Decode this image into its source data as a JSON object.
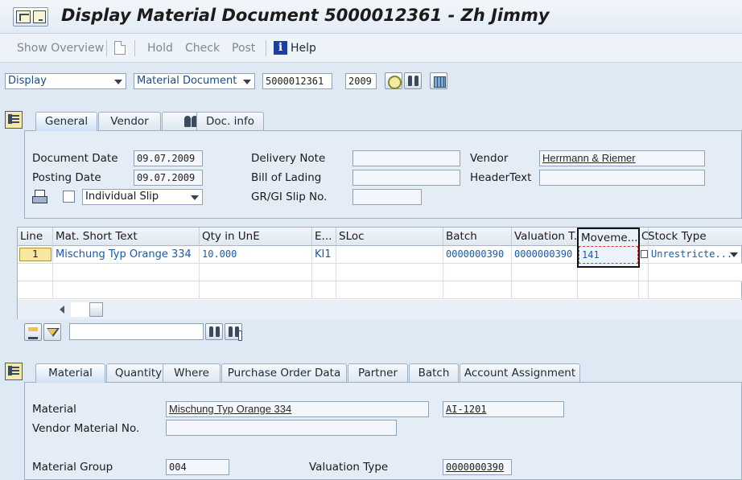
{
  "window": {
    "title": "Display Material Document 5000012361 - Zh Jimmy"
  },
  "toolbar": {
    "show_overview": "Show Overview",
    "hold": "Hold",
    "check": "Check",
    "post": "Post",
    "help": "Help"
  },
  "selection": {
    "action": "Display",
    "doc_type": "Material Document",
    "doc_number": "5000012361",
    "doc_year": "2009"
  },
  "header_tabs": [
    "General",
    "Vendor",
    "",
    "Doc. info"
  ],
  "header": {
    "document_date_label": "Document Date",
    "document_date": "09.07.2009",
    "posting_date_label": "Posting Date",
    "posting_date": "09.07.2009",
    "slip_type": "Individual Slip",
    "delivery_note_label": "Delivery Note",
    "delivery_note": "",
    "bill_of_lading_label": "Bill of Lading",
    "bill_of_lading": "",
    "grgi_slip_label": "GR/GI Slip No.",
    "grgi_slip": "",
    "vendor_label": "Vendor",
    "vendor": "Herrmann & Riemer",
    "header_text_label": "HeaderText",
    "header_text": ""
  },
  "table": {
    "columns": [
      "Line",
      "Mat. Short Text",
      "Qty in UnE",
      "E...",
      "SLoc",
      "Batch",
      "Valuation T...",
      "Moveme...",
      "C",
      "Stock Type"
    ],
    "rows": [
      {
        "line": "1",
        "mat_text": "Mischung Typ Orange 334",
        "qty": "10.000",
        "unit": "KI1",
        "sloc": "",
        "batch": "0000000390",
        "valuation": "0000000390",
        "movement": "141",
        "stock_type": "Unrestricte..."
      }
    ]
  },
  "table_search": {
    "value": ""
  },
  "item_tabs": [
    "Material",
    "Quantity",
    "Where",
    "Purchase Order Data",
    "Partner",
    "Batch",
    "Account Assignment"
  ],
  "item": {
    "material_label": "Material",
    "material_text": "Mischung Typ Orange 334",
    "material_number": "AI-1201",
    "vendor_material_label": "Vendor Material No.",
    "vendor_material": "",
    "material_group_label": "Material Group",
    "material_group": "004",
    "valuation_type_label": "Valuation Type",
    "valuation_type": "0000000390"
  },
  "icons": [
    "menu-icon",
    "new-document-icon",
    "help-icon",
    "clock-icon",
    "binoculars-icon",
    "layout-grid-icon",
    "expand-section-icon",
    "print-icon",
    "sort-icon",
    "filter-icon",
    "find-icon",
    "find-next-icon"
  ],
  "colors": {
    "background": "#dfe9f4",
    "field_text": "#1a5aa8",
    "line_highlight": "#f7e7a0"
  }
}
